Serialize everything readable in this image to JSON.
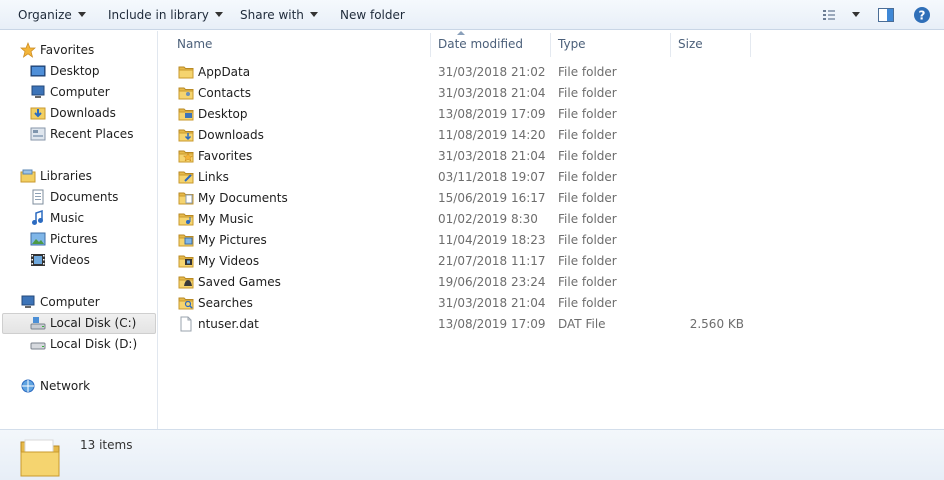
{
  "toolbar": {
    "organize": "Organize",
    "include_in_library": "Include in library",
    "share_with": "Share with",
    "new_folder": "New folder"
  },
  "nav": {
    "favorites": "Favorites",
    "favorites_items": [
      "Desktop",
      "Computer",
      "Downloads",
      "Recent Places"
    ],
    "libraries": "Libraries",
    "libraries_items": [
      "Documents",
      "Music",
      "Pictures",
      "Videos"
    ],
    "computer": "Computer",
    "computer_items": [
      "Local Disk (C:)",
      "Local Disk (D:)"
    ],
    "network": "Network",
    "selected": "Local Disk (C:)"
  },
  "columns": {
    "name": "Name",
    "date_modified": "Date modified",
    "type": "Type",
    "size": "Size"
  },
  "files": [
    {
      "name": "AppData",
      "date": "31/03/2018 21:02",
      "type": "File folder",
      "size": "",
      "icon": "folder-icon"
    },
    {
      "name": "Contacts",
      "date": "31/03/2018 21:04",
      "type": "File folder",
      "size": "",
      "icon": "contacts-folder-icon"
    },
    {
      "name": "Desktop",
      "date": "13/08/2019 17:09",
      "type": "File folder",
      "size": "",
      "icon": "desktop-folder-icon"
    },
    {
      "name": "Downloads",
      "date": "11/08/2019 14:20",
      "type": "File folder",
      "size": "",
      "icon": "downloads-folder-icon"
    },
    {
      "name": "Favorites",
      "date": "31/03/2018 21:04",
      "type": "File folder",
      "size": "",
      "icon": "favorites-folder-icon"
    },
    {
      "name": "Links",
      "date": "03/11/2018 19:07",
      "type": "File folder",
      "size": "",
      "icon": "links-folder-icon"
    },
    {
      "name": "My Documents",
      "date": "15/06/2019 16:17",
      "type": "File folder",
      "size": "",
      "icon": "documents-folder-icon"
    },
    {
      "name": "My Music",
      "date": "01/02/2019 8:30",
      "type": "File folder",
      "size": "",
      "icon": "music-folder-icon"
    },
    {
      "name": "My Pictures",
      "date": "11/04/2019 18:23",
      "type": "File folder",
      "size": "",
      "icon": "pictures-folder-icon"
    },
    {
      "name": "My Videos",
      "date": "21/07/2018 11:17",
      "type": "File folder",
      "size": "",
      "icon": "videos-folder-icon"
    },
    {
      "name": "Saved Games",
      "date": "19/06/2018 23:24",
      "type": "File folder",
      "size": "",
      "icon": "saved-games-folder-icon"
    },
    {
      "name": "Searches",
      "date": "31/03/2018 21:04",
      "type": "File folder",
      "size": "",
      "icon": "searches-folder-icon"
    },
    {
      "name": "ntuser.dat",
      "date": "13/08/2019 17:09",
      "type": "DAT File",
      "size": "2.560 KB",
      "icon": "file-icon"
    }
  ],
  "status": {
    "item_count": "13 items"
  },
  "icons": {
    "toolbar_right": [
      "view-options-icon",
      "preview-pane-icon",
      "help-icon"
    ]
  },
  "colors": {
    "folder": "#f2cf62",
    "selection": "#e6e6e6",
    "header_text": "#4c607a"
  }
}
